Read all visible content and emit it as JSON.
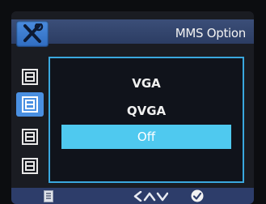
{
  "header": {
    "title": "MMS Option",
    "tab_icon": "tools-icon"
  },
  "sidebar": {
    "items": [
      {
        "icon": "menu-page-icon"
      },
      {
        "icon": "menu-page-icon",
        "active": true
      },
      {
        "icon": "menu-page-icon"
      },
      {
        "icon": "menu-page-icon"
      }
    ]
  },
  "options": {
    "items": [
      {
        "label": "VGA"
      },
      {
        "label": "QVGA"
      },
      {
        "label": "Off",
        "selected": true
      }
    ]
  },
  "bottom_bar": {
    "icons": [
      "menu-icon",
      "nav-arrows-icon",
      "confirm-icon"
    ]
  },
  "colors": {
    "accent": "#4fc9ef",
    "header": "#2c3d63",
    "panel_border": "#3aa8de"
  }
}
